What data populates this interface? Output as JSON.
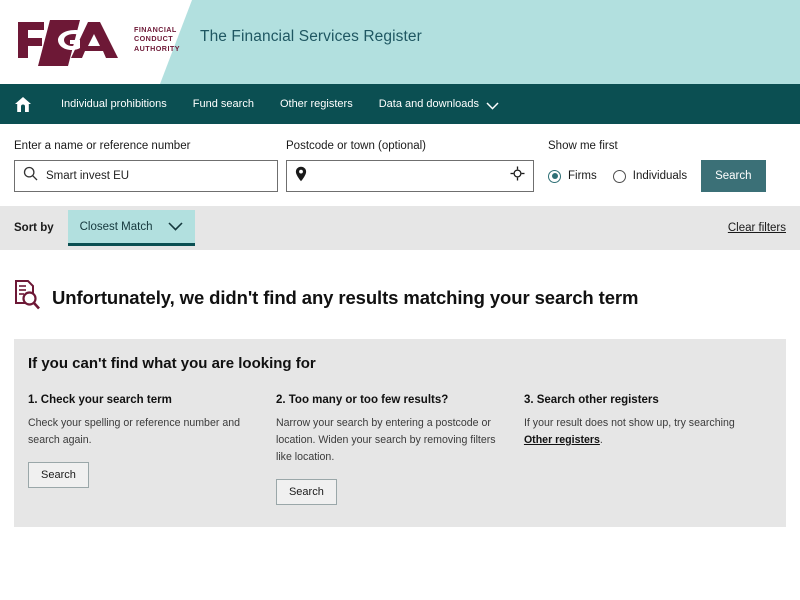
{
  "brand": {
    "logo_letters": "FCA",
    "logo_line1": "FINANCIAL",
    "logo_line2": "CONDUCT",
    "logo_line3": "AUTHORITY",
    "logo_color": "#6d1836",
    "site_title": "The Financial Services Register",
    "teal_accent": "#b2e0df",
    "nav_color": "#0b4f52"
  },
  "nav": {
    "home_icon": "home-icon",
    "items": [
      {
        "label": "Individual prohibitions",
        "has_chevron": false
      },
      {
        "label": "Fund search",
        "has_chevron": false
      },
      {
        "label": "Other registers",
        "has_chevron": false
      },
      {
        "label": "Data and downloads",
        "has_chevron": true
      }
    ]
  },
  "search": {
    "name_label": "Enter a name or reference number",
    "name_value": "Smart invest EU",
    "name_placeholder": "",
    "name_icon": "search-icon",
    "postcode_label": "Postcode or town (optional)",
    "postcode_value": "",
    "postcode_placeholder": "",
    "postcode_icon": "location-pin-icon",
    "geolocate_icon": "crosshair-icon",
    "show_me_first_label": "Show me first",
    "options": [
      {
        "label": "Firms",
        "selected": true
      },
      {
        "label": "Individuals",
        "selected": false
      }
    ],
    "search_button": "Search",
    "search_button_color": "#3b7077"
  },
  "sort": {
    "label": "Sort by",
    "selected": "Closest Match",
    "chevron_icon": "chevron-down-icon",
    "clear_filters": "Clear filters"
  },
  "results": {
    "icon": "document-search-icon",
    "heading": "Unfortunately, we didn't find any results matching your search term"
  },
  "help": {
    "heading": "If you can't find what you are looking for",
    "columns": [
      {
        "title": "1. Check your search term",
        "body": "Check your spelling or reference number and search again.",
        "button": "Search",
        "link": "",
        "body_after_link": ""
      },
      {
        "title": "2. Too many or too few results?",
        "body": "Narrow your search by entering a postcode or location. Widen your search by removing filters like location.",
        "button": "Search",
        "link": "",
        "body_after_link": ""
      },
      {
        "title": "3. Search other registers",
        "body": "If your result does not show up, try searching ",
        "button": "",
        "link": "Other registers",
        "body_after_link": "."
      }
    ]
  }
}
